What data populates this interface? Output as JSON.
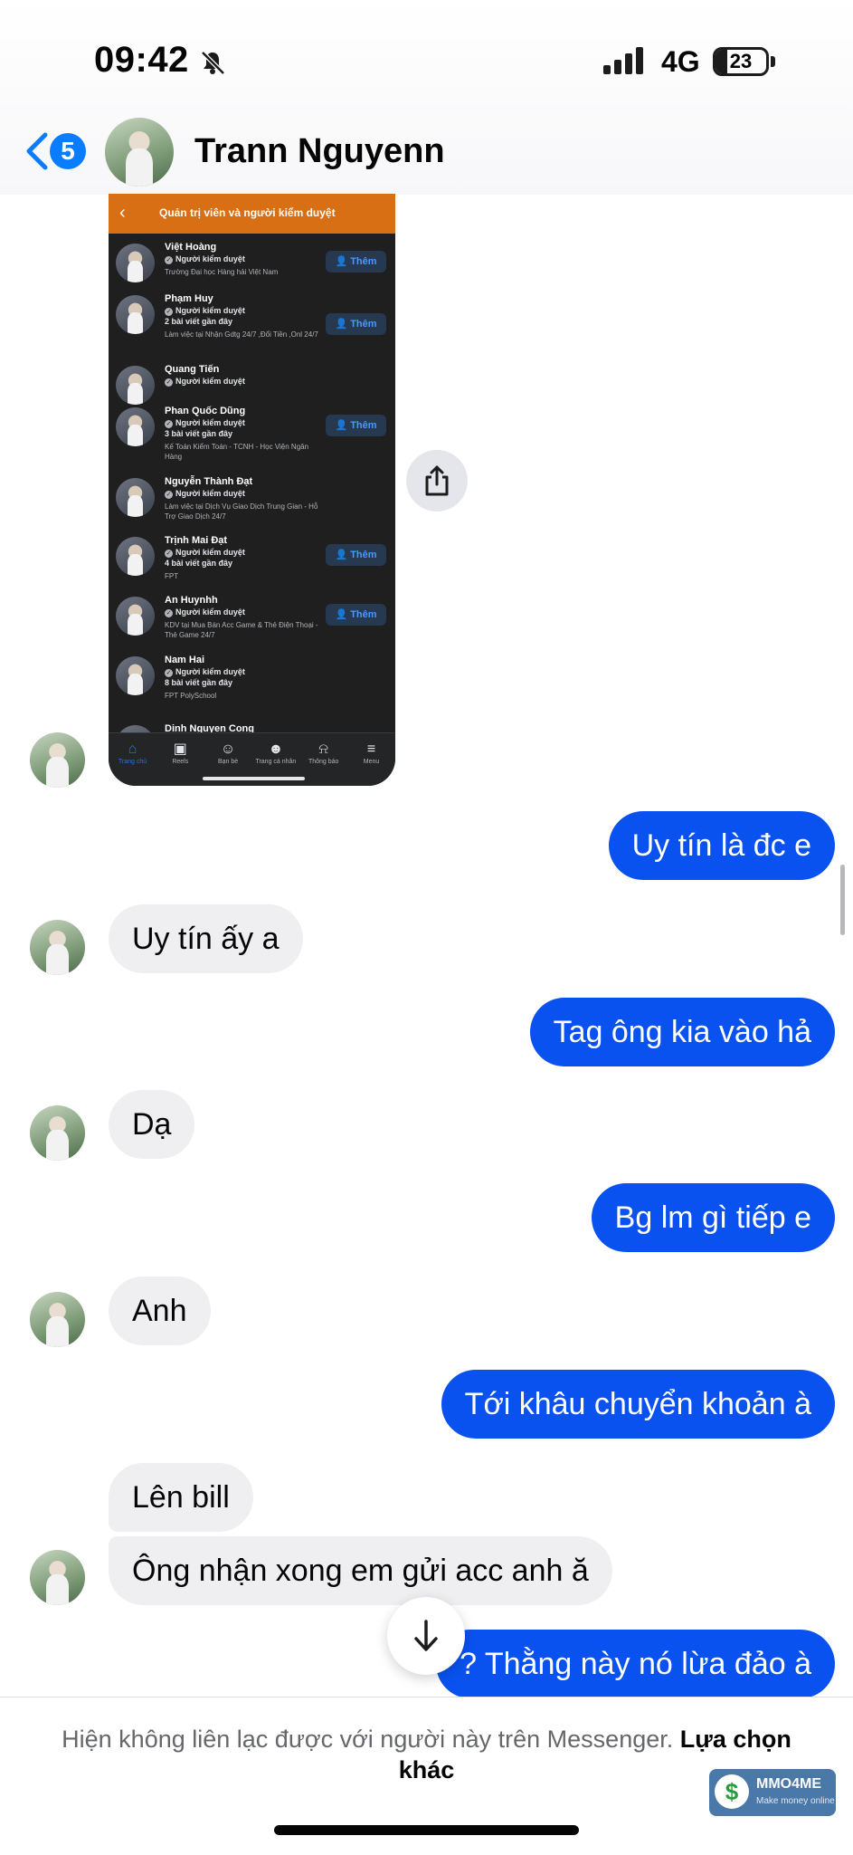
{
  "status_bar": {
    "time": "09:42",
    "network": "4G",
    "battery": "23",
    "battery_level": 0.23
  },
  "header": {
    "unread_count": "5",
    "contact_name": "Trann Nguyenn"
  },
  "screenshot": {
    "title": "Quản trị viên và người kiểm duyệt",
    "add_label": "Thêm",
    "members": [
      {
        "name": "Việt Hoàng",
        "role": "Người kiểm duyệt",
        "posts": "",
        "detail": "Trường Đại học Hàng hải Việt Nam"
      },
      {
        "name": "Phạm Huy",
        "role": "Người kiểm duyệt",
        "posts": "2 bài viết gần đây",
        "detail": "Làm việc tại Nhận Gdtg 24/7 ,Đổi Tiền ,Onl 24/7"
      },
      {
        "name": "Quang Tiến",
        "role": "Người kiểm duyệt",
        "posts": "",
        "detail": ""
      },
      {
        "name": "Phan Quốc Dũng",
        "role": "Người kiểm duyệt",
        "posts": "3 bài viết gần đây",
        "detail": "Kế Toán Kiểm Toán - TCNH - Học Viện Ngân Hàng"
      },
      {
        "name": "Nguyễn Thành Đạt",
        "role": "Người kiểm duyệt",
        "posts": "",
        "detail": "Làm việc tại Dịch Vụ Giao Dịch Trung Gian - Hỗ Trợ Giao Dịch 24/7"
      },
      {
        "name": "Trịnh Mai Đạt",
        "role": "Người kiểm duyệt",
        "posts": "4 bài viết gần đây",
        "detail": "FPT"
      },
      {
        "name": "An Huynhh",
        "role": "Người kiểm duyệt",
        "posts": "",
        "detail": "KDV tại Mua Bán Acc Game & Thẻ Điện Thoại - Thẻ Game 24/7"
      },
      {
        "name": "Nam Hai",
        "role": "Người kiểm duyệt",
        "posts": "8 bài viết gần đây",
        "detail": "FPT PolySchool"
      },
      {
        "name": "Dinh Nguyen Cong",
        "role": "",
        "posts": "",
        "detail": ""
      }
    ],
    "nav": [
      "Trang chủ",
      "Reels",
      "Bạn bè",
      "Trang cá nhân",
      "Thông báo",
      "Menu"
    ]
  },
  "messages": [
    {
      "side": "sent",
      "text": "Uy tín là đc e"
    },
    {
      "side": "received",
      "text": "Uy tín ấy a"
    },
    {
      "side": "sent",
      "text": "Tag ông kia vào hả"
    },
    {
      "side": "received",
      "text": "Dạ"
    },
    {
      "side": "sent",
      "text": "Bg lm gì tiếp e"
    },
    {
      "side": "received",
      "text": "Anh"
    },
    {
      "side": "sent",
      "text": "Tới khâu chuyển khoản à"
    },
    {
      "side": "received",
      "text": "Lên bill"
    },
    {
      "side": "received",
      "text": "Ông nhận xong em gửi acc anh ă"
    },
    {
      "side": "sent",
      "text": "? Thằng này nó lừa đảo à"
    }
  ],
  "footer": {
    "notice": "Hiện không liên lạc được với người này trên Messenger.",
    "link": "Lựa chọn khác"
  },
  "watermark": {
    "name": "MMO4ME",
    "tagline": "Make money online"
  },
  "colors": {
    "sent_bubble": "#0a52f0",
    "received_bubble": "#efeff2",
    "badge": "#0a7cff",
    "screenshot_header": "#d86f14"
  }
}
